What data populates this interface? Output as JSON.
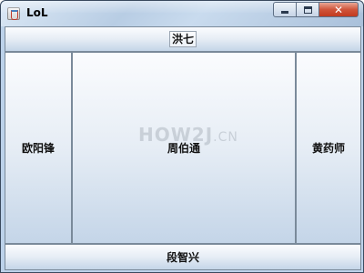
{
  "window": {
    "title": "LoL",
    "controls": {
      "minimize_icon": "minimize-icon",
      "maximize_icon": "maximize-icon",
      "close_label": "✕"
    }
  },
  "layout": {
    "north": {
      "label": "洪七"
    },
    "west": {
      "label": "欧阳锋"
    },
    "center": {
      "label": "周伯通",
      "watermark": "HOW2J",
      "watermark_suffix": ".CN"
    },
    "east": {
      "label": "黄药师"
    },
    "south": {
      "label": "段智兴"
    }
  },
  "colors": {
    "titlebar": "#bcd2ea",
    "button_gradient_top": "#fbfcfe",
    "button_gradient_bottom": "#c4d5e8",
    "close_button": "#c23a1f"
  }
}
